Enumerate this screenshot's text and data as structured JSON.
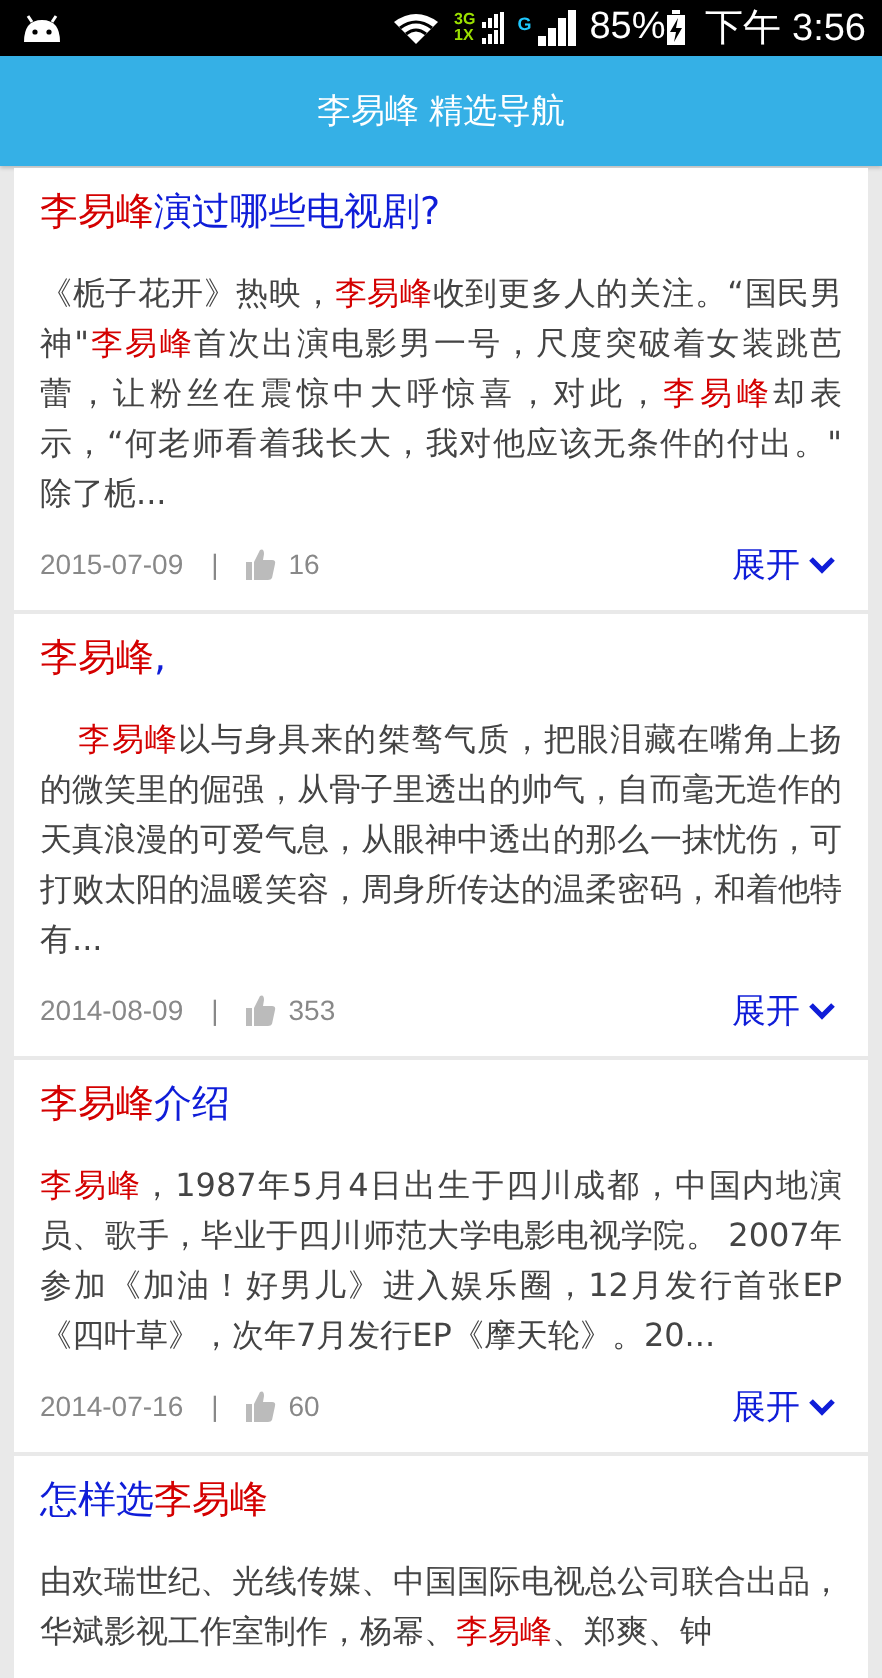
{
  "status_bar": {
    "network_3g": "3G",
    "network_1x": "1X",
    "network_g": "G",
    "battery": "85%",
    "time": "下午 3:56"
  },
  "header": {
    "title": "李易峰 精选导航"
  },
  "articles": [
    {
      "title": [
        {
          "text": "李易峰",
          "highlight": true
        },
        {
          "text": "演过哪些电视剧?",
          "highlight": false
        }
      ],
      "body": [
        {
          "text": "《栀子花开》热映，",
          "highlight": false
        },
        {
          "text": "李易峰",
          "highlight": true
        },
        {
          "text": "收到更多人的关注。“国民男神\"",
          "highlight": false
        },
        {
          "text": "李易峰",
          "highlight": true
        },
        {
          "text": "首次出演电影男一号，尺度突破着女装跳芭蕾，让粉丝在震惊中大呼惊喜，对此，",
          "highlight": false
        },
        {
          "text": "李易峰",
          "highlight": true
        },
        {
          "text": "却表示，“何老师看着我长大，我对他应该无条件的付出。\" 除了栀...",
          "highlight": false
        }
      ],
      "date": "2015-07-09",
      "separator": "|",
      "likes": "16",
      "expand": "展开"
    },
    {
      "title": [
        {
          "text": "李易峰",
          "highlight": true
        },
        {
          "text": ",",
          "highlight": false
        }
      ],
      "indent": true,
      "body": [
        {
          "text": "李易峰",
          "highlight": true
        },
        {
          "text": "以与身具来的桀骜气质，把眼泪藏在嘴角上扬的微笑里的倔强，从骨子里透出的帅气，自而毫无造作的天真浪漫的可爱气息，从眼神中透出的那么一抹忧伤，可打败太阳的温暖笑容，周身所传达的温柔密码，和着他特有...",
          "highlight": false
        }
      ],
      "date": "2014-08-09",
      "separator": "|",
      "likes": "353",
      "expand": "展开"
    },
    {
      "title": [
        {
          "text": "李易峰",
          "highlight": true
        },
        {
          "text": "介绍",
          "highlight": false
        }
      ],
      "body": [
        {
          "text": "李易峰",
          "highlight": true
        },
        {
          "text": "，1987年5月4日出生于四川成都，中国内地演员、歌手，毕业于四川师范大学电影电视学院。 2007年参加《加油！好男儿》进入娱乐圈，12月发行首张EP《四叶草》，次年7月发行EP《摩天轮》。20...",
          "highlight": false
        }
      ],
      "date": "2014-07-16",
      "separator": "|",
      "likes": "60",
      "expand": "展开"
    },
    {
      "title": [
        {
          "text": "怎样选",
          "highlight": false
        },
        {
          "text": "李易峰",
          "highlight": true
        }
      ],
      "body": [
        {
          "text": "由欢瑞世纪、光线传媒、中国国际电视总公司联合出品，华斌影视工作室制作，杨幂、",
          "highlight": false
        },
        {
          "text": "李易峰",
          "highlight": true
        },
        {
          "text": "、郑爽、钟",
          "highlight": false
        }
      ]
    }
  ]
}
